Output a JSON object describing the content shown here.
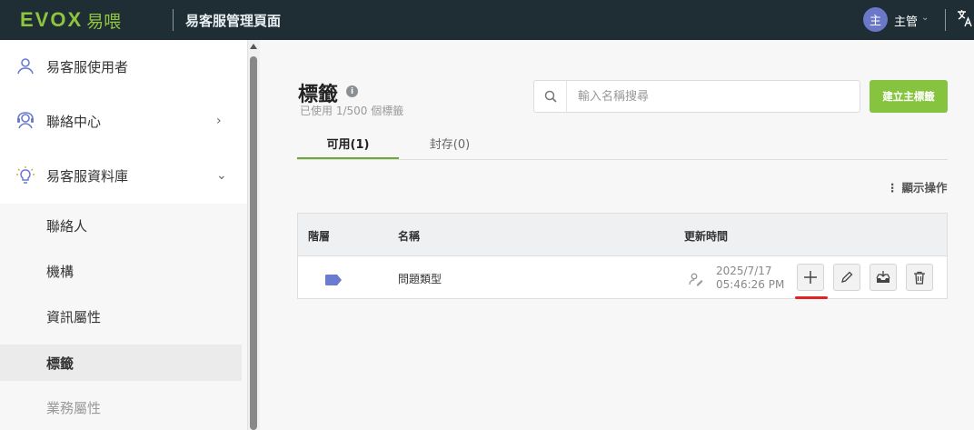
{
  "topbar": {
    "logo_text": "EVOX",
    "logo_cn": "易喂",
    "app_title": "易客服管理頁面",
    "avatar_initial": "主",
    "user_name": "主管",
    "lang_icon": "translate-icon"
  },
  "sidebar": {
    "items": [
      {
        "label": "易客服使用者",
        "icon": "user-icon"
      },
      {
        "label": "聯絡中心",
        "icon": "contact-center-icon",
        "chevron": "›"
      },
      {
        "label": "易客服資料庫",
        "icon": "lightbulb-icon",
        "chevron": "⌄"
      }
    ],
    "sub_items": [
      {
        "label": "聯絡人"
      },
      {
        "label": "機構"
      },
      {
        "label": "資訊屬性"
      },
      {
        "label": "標籤"
      },
      {
        "label": "業務屬性"
      }
    ]
  },
  "main": {
    "title": "標籤",
    "info_glyph": "i",
    "usage": "已使用 1/500 個標籤",
    "search_placeholder": "輸入名稱搜尋",
    "create_button": "建立主標籤",
    "tabs": [
      {
        "label": "可用(1)",
        "active": true
      },
      {
        "label": "封存(0)",
        "active": false
      }
    ],
    "show_actions": "顯示操作",
    "table": {
      "headers": [
        "階層",
        "名稱",
        "更新時間"
      ],
      "rows": [
        {
          "name": "問題類型",
          "date": "2025/7/17",
          "time": "05:46:26 PM"
        }
      ]
    }
  },
  "colors": {
    "topbar_bg": "#1f2e35",
    "brand_green": "#8fc43f",
    "button_green": "#86c440",
    "tab_accent": "#6aab35",
    "tag_color": "#6a7bd0",
    "highlight_red": "#e02424"
  }
}
